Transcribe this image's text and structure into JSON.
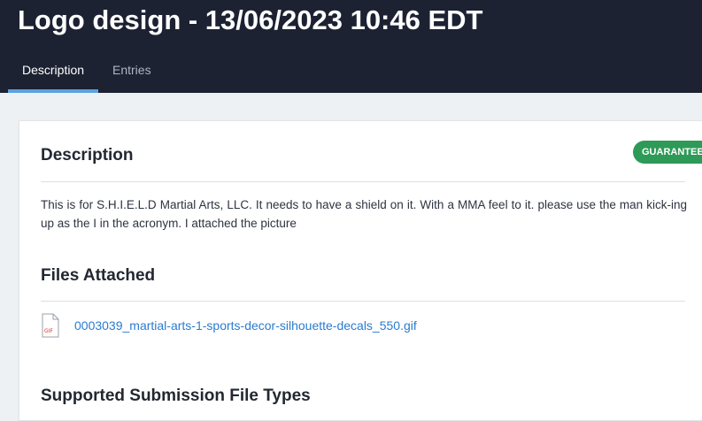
{
  "header": {
    "title": "Logo design - 13/06/2023 10:46 EDT",
    "tabs": [
      {
        "label": "Description",
        "active": true
      },
      {
        "label": "Entries",
        "active": false
      }
    ]
  },
  "description": {
    "heading": "Description",
    "badge": "GUARANTEED",
    "badge_color": "#2e9a57",
    "text": "This is for S.H.I.E.L.D Martial Arts, LLC. It needs to have a shield on it. With a MMA feel to it. please use the man kick-ing up as the I in the acronym. I attached the picture"
  },
  "files": {
    "heading": "Files Attached",
    "items": [
      {
        "icon": "gif-file-icon",
        "icon_label": "GIF",
        "name": "0003039_martial-arts-1-sports-decor-silhouette-decals_550.gif"
      }
    ]
  },
  "submission": {
    "heading": "Supported Submission File Types"
  },
  "colors": {
    "header_bg": "#1c2232",
    "tab_underline": "#5aa2e3",
    "link": "#2a7bd1"
  }
}
